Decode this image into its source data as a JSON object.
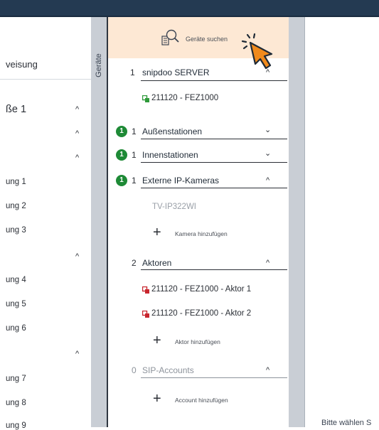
{
  "left_panel": {
    "title": "veisung",
    "items": [
      {
        "label": "ße 1",
        "chevron": "^"
      },
      {
        "label": "",
        "chevron": "^"
      },
      {
        "label": "",
        "chevron": "^"
      },
      {
        "label": "ung 1"
      },
      {
        "label": "ung 2"
      },
      {
        "label": "ung 3"
      },
      {
        "label": "",
        "chevron": "^"
      },
      {
        "label": "ung 4"
      },
      {
        "label": "ung 5"
      },
      {
        "label": "ung 6"
      },
      {
        "label": "",
        "chevron": "^"
      },
      {
        "label": "ung 7"
      },
      {
        "label": "ung 8"
      },
      {
        "label": "ung 9"
      }
    ]
  },
  "devices_strip": {
    "label": "Geräte"
  },
  "device_panel": {
    "search_label": "Geräte suchen",
    "sections": {
      "server": {
        "count": "1",
        "title": "snipdoo SERVER",
        "chevron": "^",
        "device": "211120 - FEZ1000"
      },
      "outdoor": {
        "badge": "1",
        "count": "1",
        "title": "Außenstationen",
        "chevron": "⌄"
      },
      "indoor": {
        "badge": "1",
        "count": "1",
        "title": "Innenstationen",
        "chevron": "⌄"
      },
      "cameras": {
        "badge": "1",
        "count": "1",
        "title": "Externe IP-Kameras",
        "chevron": "^",
        "camera": "TV-IP322WI",
        "add_label": "Kamera hinzufügen"
      },
      "actors": {
        "count": "2",
        "title": "Aktoren",
        "chevron": "^",
        "devices": [
          "211120 - FEZ1000 - Aktor 1",
          "211120 - FEZ1000 - Aktor 2"
        ],
        "add_label": "Aktor hinzufügen"
      },
      "sip": {
        "count": "0",
        "title": "SIP-Accounts",
        "chevron": "^",
        "add_label": "Account hinzufügen"
      }
    }
  },
  "right_panel": {
    "hint": "Bitte wählen S"
  },
  "colors": {
    "topbar": "#243a52",
    "search_bg": "#fde8d4",
    "strip": "#c9ced5",
    "badge": "#1e8a36",
    "server_icon": "#2e9a3a",
    "actor_icon": "#c8262e",
    "cursor": "#f08a1c"
  }
}
